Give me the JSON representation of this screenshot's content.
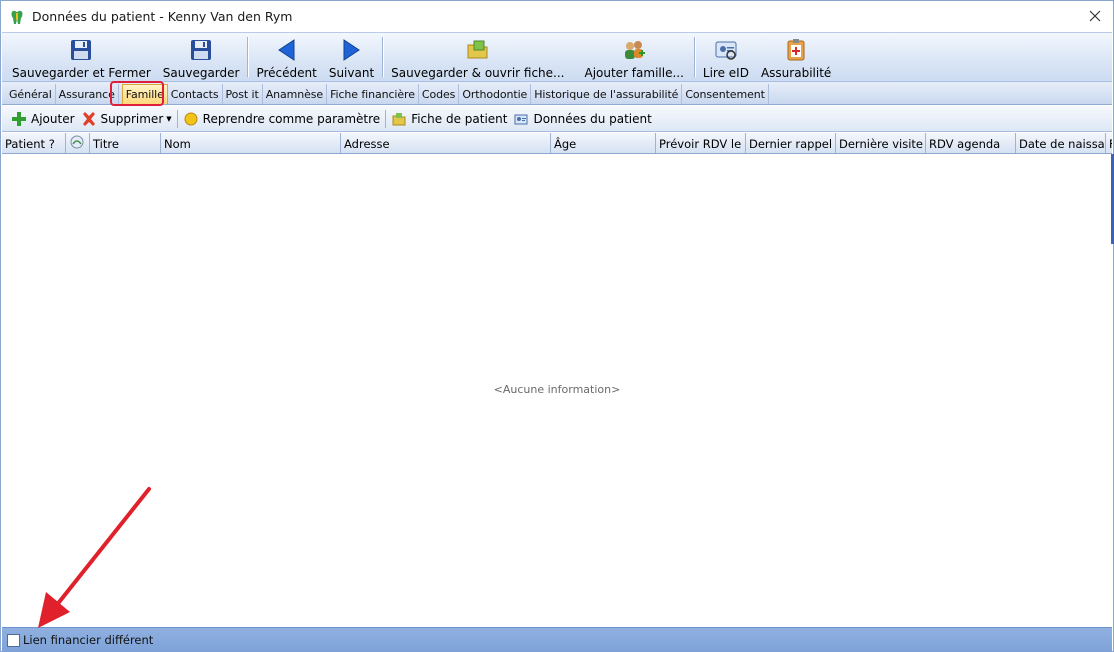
{
  "window": {
    "title": "Données du patient - Kenny Van den Rym"
  },
  "ribbon": {
    "buttons": [
      {
        "label": "Sauvegarder et Fermer",
        "icon": "floppy-disk-icon"
      },
      {
        "label": "Sauvegarder",
        "icon": "floppy-disk-icon"
      },
      {
        "label": "Précédent",
        "icon": "arrow-left-icon"
      },
      {
        "label": "Suivant",
        "icon": "arrow-right-icon"
      },
      {
        "label": "Sauvegarder & ouvrir fiche...",
        "icon": "folder-open-icon"
      },
      {
        "label": "Ajouter famille...",
        "icon": "add-family-icon"
      },
      {
        "label": "Lire eID",
        "icon": "eid-card-icon"
      },
      {
        "label": "Assurabilité",
        "icon": "clipboard-medical-icon"
      }
    ]
  },
  "tabs": [
    {
      "label": "Général"
    },
    {
      "label": "Assurance"
    },
    {
      "label": "Famille",
      "active": true
    },
    {
      "label": "Contacts"
    },
    {
      "label": "Post it"
    },
    {
      "label": "Anamnèse"
    },
    {
      "label": "Fiche financière"
    },
    {
      "label": "Codes"
    },
    {
      "label": "Orthodontie"
    },
    {
      "label": "Historique de l'assurabilité"
    },
    {
      "label": "Consentement"
    }
  ],
  "subtoolbar": {
    "add": "Ajouter",
    "delete": "Supprimer",
    "use_as_param": "Reprendre comme paramètre",
    "patient_file": "Fiche de patient",
    "patient_data": "Données du patient"
  },
  "grid": {
    "columns": [
      "Patient ?",
      "",
      "Titre",
      "Nom",
      "Adresse",
      "Âge",
      "Prévoir RDV le",
      "Dernier rappel",
      "Dernière visite",
      "RDV agenda",
      "Date de naissance",
      "F"
    ],
    "empty_text": "<Aucune information>"
  },
  "footer": {
    "checkbox_label": "Lien financier différent",
    "checked": false
  },
  "colors": {
    "accent": "#e0203a",
    "footer": "#7ea2d8",
    "active_tab": "#ffd77a"
  }
}
